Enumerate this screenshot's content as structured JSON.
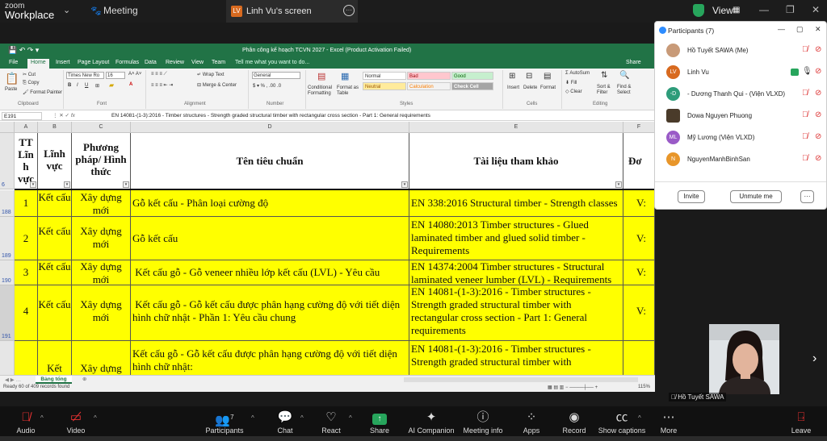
{
  "zoom": {
    "logo_top": "zoom",
    "logo_bottom": "Workplace",
    "meeting_tab": "Meeting",
    "share_badge": "LV",
    "share_title": "Linh Vu's screen",
    "view_label": "View"
  },
  "excel": {
    "title": "Phân công kế hoạch TCVN 2027 - Excel (Product Activation Failed)",
    "menu": [
      "File",
      "Home",
      "Insert",
      "Page Layout",
      "Formulas",
      "Data",
      "Review",
      "View",
      "Team"
    ],
    "tell_me": "Tell me what you want to do...",
    "share": "Share",
    "ribbon": {
      "paste": "Paste",
      "cut": "Cut",
      "copy": "Copy",
      "format_painter": "Format Painter",
      "clipboard": "Clipboard",
      "font_name": "Times New Ro",
      "font_size": "16",
      "font_group": "Font",
      "wrap_text": "Wrap Text",
      "merge_center": "Merge & Center",
      "alignment": "Alignment",
      "number_format": "General",
      "number": "Number",
      "conditional": "Conditional Formatting",
      "format_table": "Format as Table",
      "styles_group": "Styles",
      "style_normal": "Normal",
      "style_bad": "Bad",
      "style_good": "Good",
      "style_neutral": "Neutral",
      "style_calc": "Calculation",
      "style_check": "Check Cell",
      "insert": "Insert",
      "delete": "Delete",
      "format": "Format",
      "cells": "Cells",
      "autosum": "AutoSum",
      "fill": "Fill",
      "clear": "Clear",
      "sort_filter": "Sort & Filter",
      "find_select": "Find & Select",
      "editing": "Editing"
    },
    "name_box": "E191",
    "fx": "fx",
    "formula": "EN 14081-(1-3):2016 - Timber structures - Strength graded structural timber with rectangular cross section - Part 1: General requirements",
    "columns": [
      "A",
      "B",
      "C",
      "D",
      "E",
      "F"
    ],
    "header_row": {
      "row_num": "6",
      "a": "TT Lĩn h vực",
      "b": "Lĩnh vực",
      "c": "Phương pháp/ Hình thức",
      "d": "Tên tiêu chuẩn",
      "e": "Tài liệu tham khảo",
      "f": "Đơ"
    },
    "rows": [
      {
        "num": "188",
        "a": "1",
        "b": "Kết cấu",
        "c": "Xây dựng mới",
        "d": "Gỗ kết cấu - Phân loại cường độ",
        "e": "EN 338:2016 Structural timber - Strength classes",
        "f": "V:"
      },
      {
        "num": "189",
        "a": "2",
        "b": "Kết cấu",
        "c": "Xây dựng mới",
        "d": "Gỗ kết cấu",
        "e": "EN 14080:2013 Timber structures - Glued laminated timber and glued solid timber - Requirements",
        "f": "V:"
      },
      {
        "num": "190",
        "a": "3",
        "b": "Kết cấu",
        "c": "Xây dựng mới",
        "d": " Kết cấu gỗ - Gỗ veneer nhiều lớp kết cấu (LVL) - Yêu cầu",
        "e": "EN 14374:2004 Timber structures - Structural laminated veneer lumber (LVL) - Requirements",
        "f": "V:"
      },
      {
        "num": "191",
        "a": "4",
        "b": "Kết cấu",
        "c": "Xây dựng mới",
        "d": " Kết cấu gỗ - Gỗ kết cấu được phân hạng cường độ với tiết diện hình chữ nhật - Phần 1: Yêu cầu chung",
        "e": "EN 14081-(1-3):2016 - Timber structures - Strength graded structural timber with rectangular cross section - Part 1: General requirements",
        "f": "V:"
      },
      {
        "num": "192",
        "a": "",
        "b": "Kết",
        "c": "Xây dựng",
        "d": "Kết cấu gỗ - Gỗ kết cấu được phân hạng cường độ với tiết diện hình chữ nhật:",
        "e": "EN 14081-(1-3):2016 - Timber structures - Strength graded structural timber with",
        "f": ""
      }
    ],
    "sheet_tab": "Bảng tổng",
    "status": "Ready     60 of 409 records found",
    "zoom_pct": "115%"
  },
  "participants": {
    "title": "Participants (7)",
    "list": [
      {
        "initials": "",
        "name": "Hồ Tuyết SAWA (Me)",
        "color": "#c89a78"
      },
      {
        "initials": "LV",
        "name": "Linh Vu",
        "color": "#d86a1f"
      },
      {
        "initials": "-D",
        "name": "- Dương Thanh Qui - (Viện VLXD)",
        "color": "#2e9c7a"
      },
      {
        "initials": "",
        "name": "Dowa Nguyen Phuong",
        "color": "#4a3b2a"
      },
      {
        "initials": "ML",
        "name": "Mỹ Lương (Viện VLXD)",
        "color": "#9a5bc7"
      },
      {
        "initials": "N",
        "name": "NguyenManhBinhSan",
        "color": "#e8962a"
      }
    ],
    "invite": "Invite",
    "unmute_me": "Unmute me",
    "more": "···"
  },
  "video_label": "Hồ Tuyết SAWA",
  "toolbar": {
    "audio": "Audio",
    "video": "Video",
    "participants": "Participants",
    "participants_count": "7",
    "chat": "Chat",
    "react": "React",
    "share": "Share",
    "ai": "AI Companion",
    "info": "Meeting info",
    "apps": "Apps",
    "record": "Record",
    "captions": "Show captions",
    "more": "More",
    "leave": "Leave"
  }
}
